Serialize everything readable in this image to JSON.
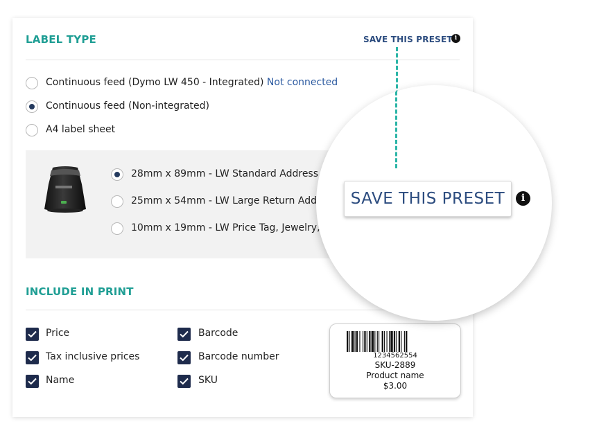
{
  "label_type": {
    "title": "LABEL TYPE",
    "save_link": "SAVE THIS PRESET",
    "info_icon": "info-icon",
    "options": [
      {
        "label": "Continuous feed (Dymo LW 450 - Integrated)",
        "status": "Not connected",
        "checked": false
      },
      {
        "label": "Continuous feed (Non-integrated)",
        "checked": true
      },
      {
        "label": "A4 label sheet",
        "checked": false
      }
    ],
    "sizes": [
      {
        "label": "28mm x 89mm - LW Standard Address (99",
        "checked": true
      },
      {
        "label": "25mm x 54mm - LW Large Return Addres",
        "checked": false
      },
      {
        "label": "10mm x 19mm - LW Price Tag, Jewelry, Du",
        "checked": false
      }
    ]
  },
  "include_in_print": {
    "title": "INCLUDE IN PRINT",
    "items": [
      {
        "label": "Price",
        "checked": true
      },
      {
        "label": "Tax inclusive prices",
        "checked": true
      },
      {
        "label": "Name",
        "checked": true
      },
      {
        "label": "Barcode",
        "checked": true
      },
      {
        "label": "Barcode number",
        "checked": true
      },
      {
        "label": "SKU",
        "checked": true
      }
    ]
  },
  "label_preview": {
    "barcode_number": "1234562554",
    "sku": "SKU-2889",
    "product_name": "Product name",
    "price": "$3.00"
  },
  "magnifier": {
    "button_label": "SAVE THIS PRESET"
  },
  "colors": {
    "accent": "#1f9e94",
    "navy": "#2c4c7f",
    "checkbox": "#1e2b4c",
    "dashed": "#2bb5a7"
  }
}
